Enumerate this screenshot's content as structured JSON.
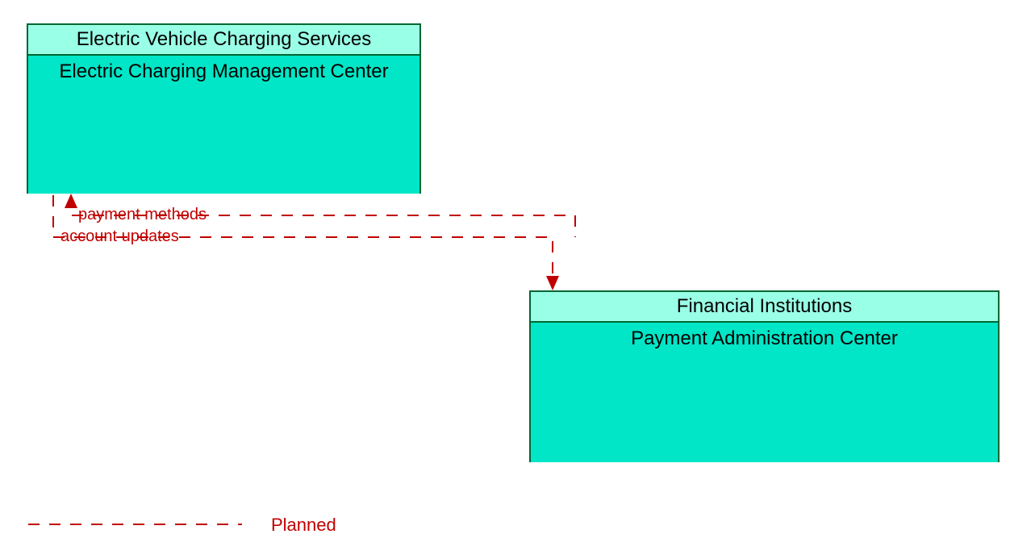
{
  "entity1": {
    "header": "Electric Vehicle Charging Services",
    "body": "Electric Charging Management Center",
    "header_bg": "#99ffe6",
    "body_bg": "#00e6c7",
    "border_color": "#006633"
  },
  "entity2": {
    "header": "Financial Institutions",
    "body": "Payment Administration Center",
    "header_bg": "#99ffe6",
    "body_bg": "#00e6c7",
    "border_color": "#006633"
  },
  "flows": {
    "flow1": "payment methods",
    "flow2": "account updates"
  },
  "legend": {
    "label": "Planned"
  },
  "connector_color": "#c00000"
}
